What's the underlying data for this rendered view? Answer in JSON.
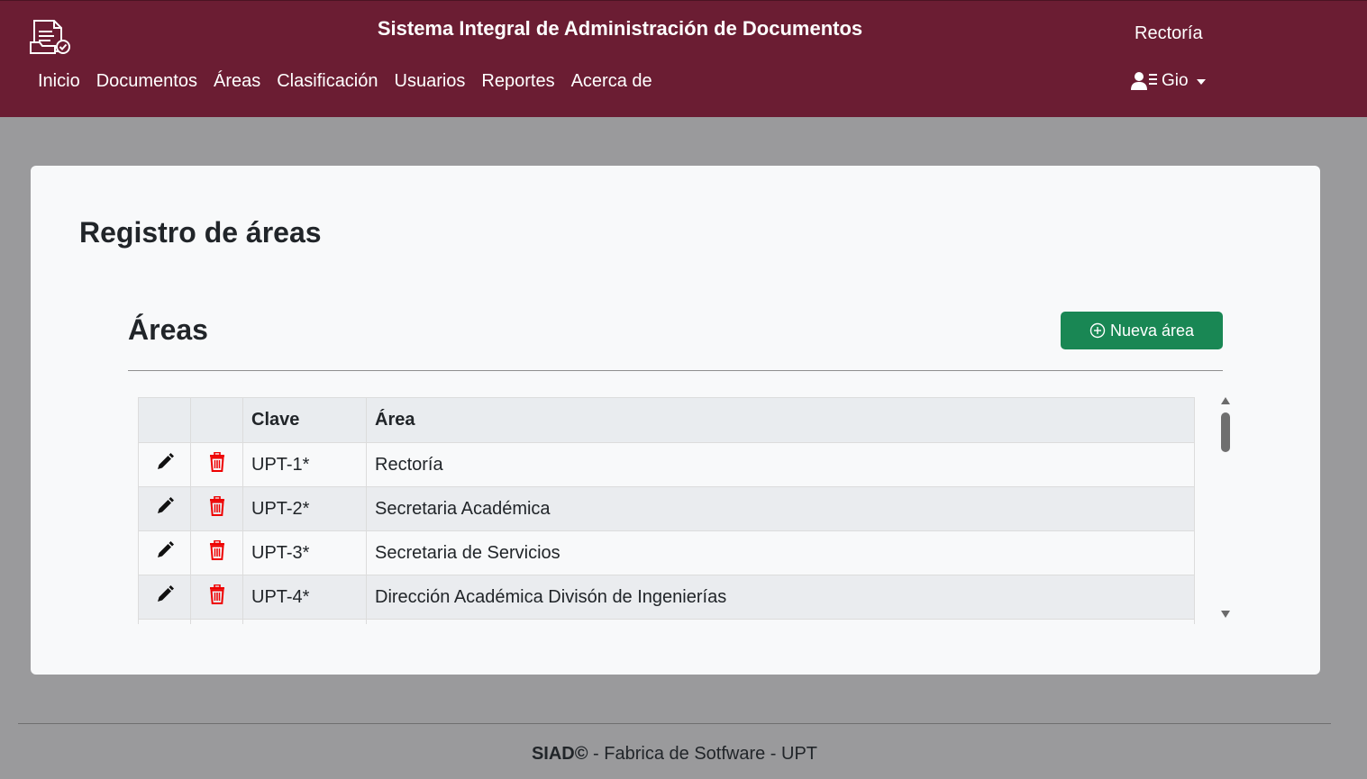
{
  "header": {
    "system_title": "Sistema Integral de Administración de Documentos",
    "area_name": "Rectoría",
    "nav": [
      "Inicio",
      "Documentos",
      "Áreas",
      "Clasificación",
      "Usuarios",
      "Reportes",
      "Acerca de"
    ],
    "user_name": "Gio",
    "bg_color": "#6b1d33"
  },
  "main": {
    "page_title": "Registro de áreas",
    "section_title": "Áreas",
    "new_button_label": "Nueva área",
    "new_button_color": "#198754",
    "table": {
      "headers": [
        "",
        "",
        "Clave",
        "Área"
      ],
      "rows": [
        {
          "clave": "UPT-1*",
          "area": "Rectoría"
        },
        {
          "clave": "UPT-2*",
          "area": "Secretaria Académica"
        },
        {
          "clave": "UPT-3*",
          "area": "Secretaria de Servicios"
        },
        {
          "clave": "UPT-4*",
          "area": "Dirección Académica Divisón de Ingenierías"
        },
        {
          "clave": "",
          "area": ""
        }
      ]
    }
  },
  "footer": {
    "brand": "SIAD©",
    "text": " - Fabrica de Sotfware - UPT"
  },
  "icons": {
    "edit": "pencil-icon",
    "delete": "trash-icon",
    "user": "user-list-icon",
    "logo": "document-check-icon",
    "add": "plus-circle-icon"
  }
}
